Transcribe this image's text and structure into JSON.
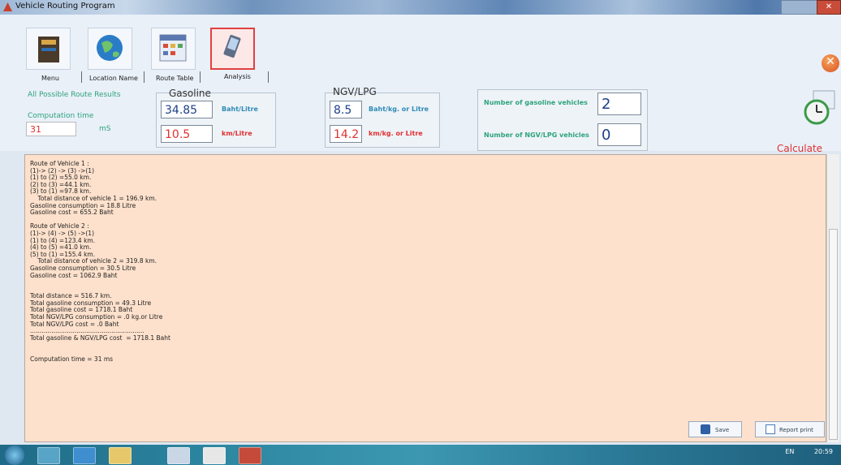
{
  "window": {
    "title": "Vehicle Routing Program"
  },
  "tabs": [
    "Menu",
    "Location Name",
    "Route Table",
    "Analysis"
  ],
  "settings": {
    "all_routes_label": "All Possible Route Results",
    "computation_label": "Computation time",
    "computation_value": "31",
    "computation_unit": "mS",
    "gasoline": {
      "title": "Gasoline",
      "price": "34.85",
      "price_unit": "Baht/Litre",
      "efficiency": "10.5",
      "efficiency_unit": "km/Litre"
    },
    "ngv": {
      "title": "NGV/LPG",
      "price": "8.5",
      "price_unit": "Baht/kg. or Litre",
      "efficiency": "14.2",
      "efficiency_unit": "km/kg. or Litre"
    },
    "vehicles": {
      "gasoline_label": "Number of gasoline vehicles",
      "gasoline_count": "2",
      "ngv_label": "Number of NGV/LPG vehicles",
      "ngv_count": "0"
    }
  },
  "calculate_label": "Calculate Now",
  "output_text": "Route of Vehicle 1 :\n(1)-> (2) -> (3) ->(1)\n(1) to (2) =55.0 km.\n(2) to (3) =44.1 km.\n(3) to (1) =97.8 km.\n    Total distance of vehicle 1 = 196.9 km.\nGasoline consumption = 18.8 Litre\nGasoline cost = 655.2 Baht\n\nRoute of Vehicle 2 :\n(1)-> (4) -> (5) ->(1)\n(1) to (4) =123.4 km.\n(4) to (5) =41.0 km.\n(5) to (1) =155.4 km.\n    Total distance of vehicle 2 = 319.8 km.\nGasoline consumption = 30.5 Litre\nGasoline cost = 1062.9 Baht\n\n\nTotal distance = 516.7 km.\nTotal gasoline consumption = 49.3 Litre\nTotal gasoline cost = 1718.1 Baht\nTotal NGV/LPG consumption = .0 kg.or Litre\nTotal NGV/LPG cost = .0 Baht\n...........................................................\nTotal gasoline & NGV/LPG cost  = 1718.1 Baht\n\n\nComputation time = 31 ms",
  "buttons": {
    "save": "Save",
    "report": "Report print"
  },
  "tray": {
    "lang": "EN",
    "time": "20:59"
  }
}
